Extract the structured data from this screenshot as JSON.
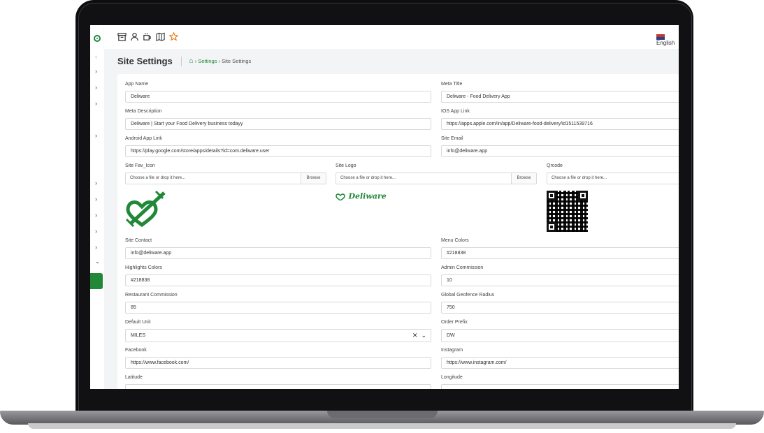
{
  "topbar": {
    "icons": [
      "archive-icon",
      "user-icon",
      "coffee-icon",
      "map-icon",
      "star-icon"
    ],
    "language": "English"
  },
  "page": {
    "title": "Site Settings",
    "breadcrumb": {
      "parent": "Settings",
      "current": "Site Settings"
    }
  },
  "form": {
    "app_name": {
      "label": "App Name",
      "value": "Deliware"
    },
    "meta_title": {
      "label": "Meta Title",
      "value": "Deliware - Food Delivery App"
    },
    "meta_description": {
      "label": "Meta Description",
      "value": "Deliware | Start your Food Delivery business todayy"
    },
    "ios_app_link": {
      "label": "IOS App Link",
      "value": "https://apps.apple.com/in/app/Deliware-food-delivery/id1511539716"
    },
    "android_app_link": {
      "label": "Android App Link",
      "value": "https://play.google.com/store/apps/details?id=com.deliware.user"
    },
    "site_email": {
      "label": "Site Email",
      "value": "info@deliware.app"
    },
    "site_fav_icon": {
      "label": "Site Fav_Icon",
      "placeholder": "Choose a file or drop it here...",
      "browse": "Browse"
    },
    "site_logo": {
      "label": "Site Logo",
      "placeholder": "Choose a file or drop it here...",
      "browse": "Browse",
      "logo_text": "Deliware"
    },
    "qrcode": {
      "label": "Qrcode",
      "placeholder": "Choose a file or drop it here..."
    },
    "site_contact": {
      "label": "Site Contact",
      "value": "info@deliware.app"
    },
    "menu_colors": {
      "label": "Menu Colors",
      "value": "#218838"
    },
    "highlights_colors": {
      "label": "Highlights Colors",
      "value": "#218838"
    },
    "admin_commission": {
      "label": "Admin Commission",
      "value": "10"
    },
    "restaurant_commission": {
      "label": "Restaurant Commission",
      "value": "85"
    },
    "global_geofence_radius": {
      "label": "Global Geofence Radius",
      "value": "750"
    },
    "default_unit": {
      "label": "Default Unit",
      "value": "MILES"
    },
    "order_prefix": {
      "label": "Order Prefix",
      "value": "DW"
    },
    "facebook": {
      "label": "Facebook",
      "value": "https://www.facebook.com/"
    },
    "instagram": {
      "label": "Instagram",
      "value": "https://www.instagram.com/"
    },
    "latitude": {
      "label": "Latitude"
    },
    "longitude": {
      "label": "Longitude"
    }
  },
  "colors": {
    "brand": "#218838"
  }
}
